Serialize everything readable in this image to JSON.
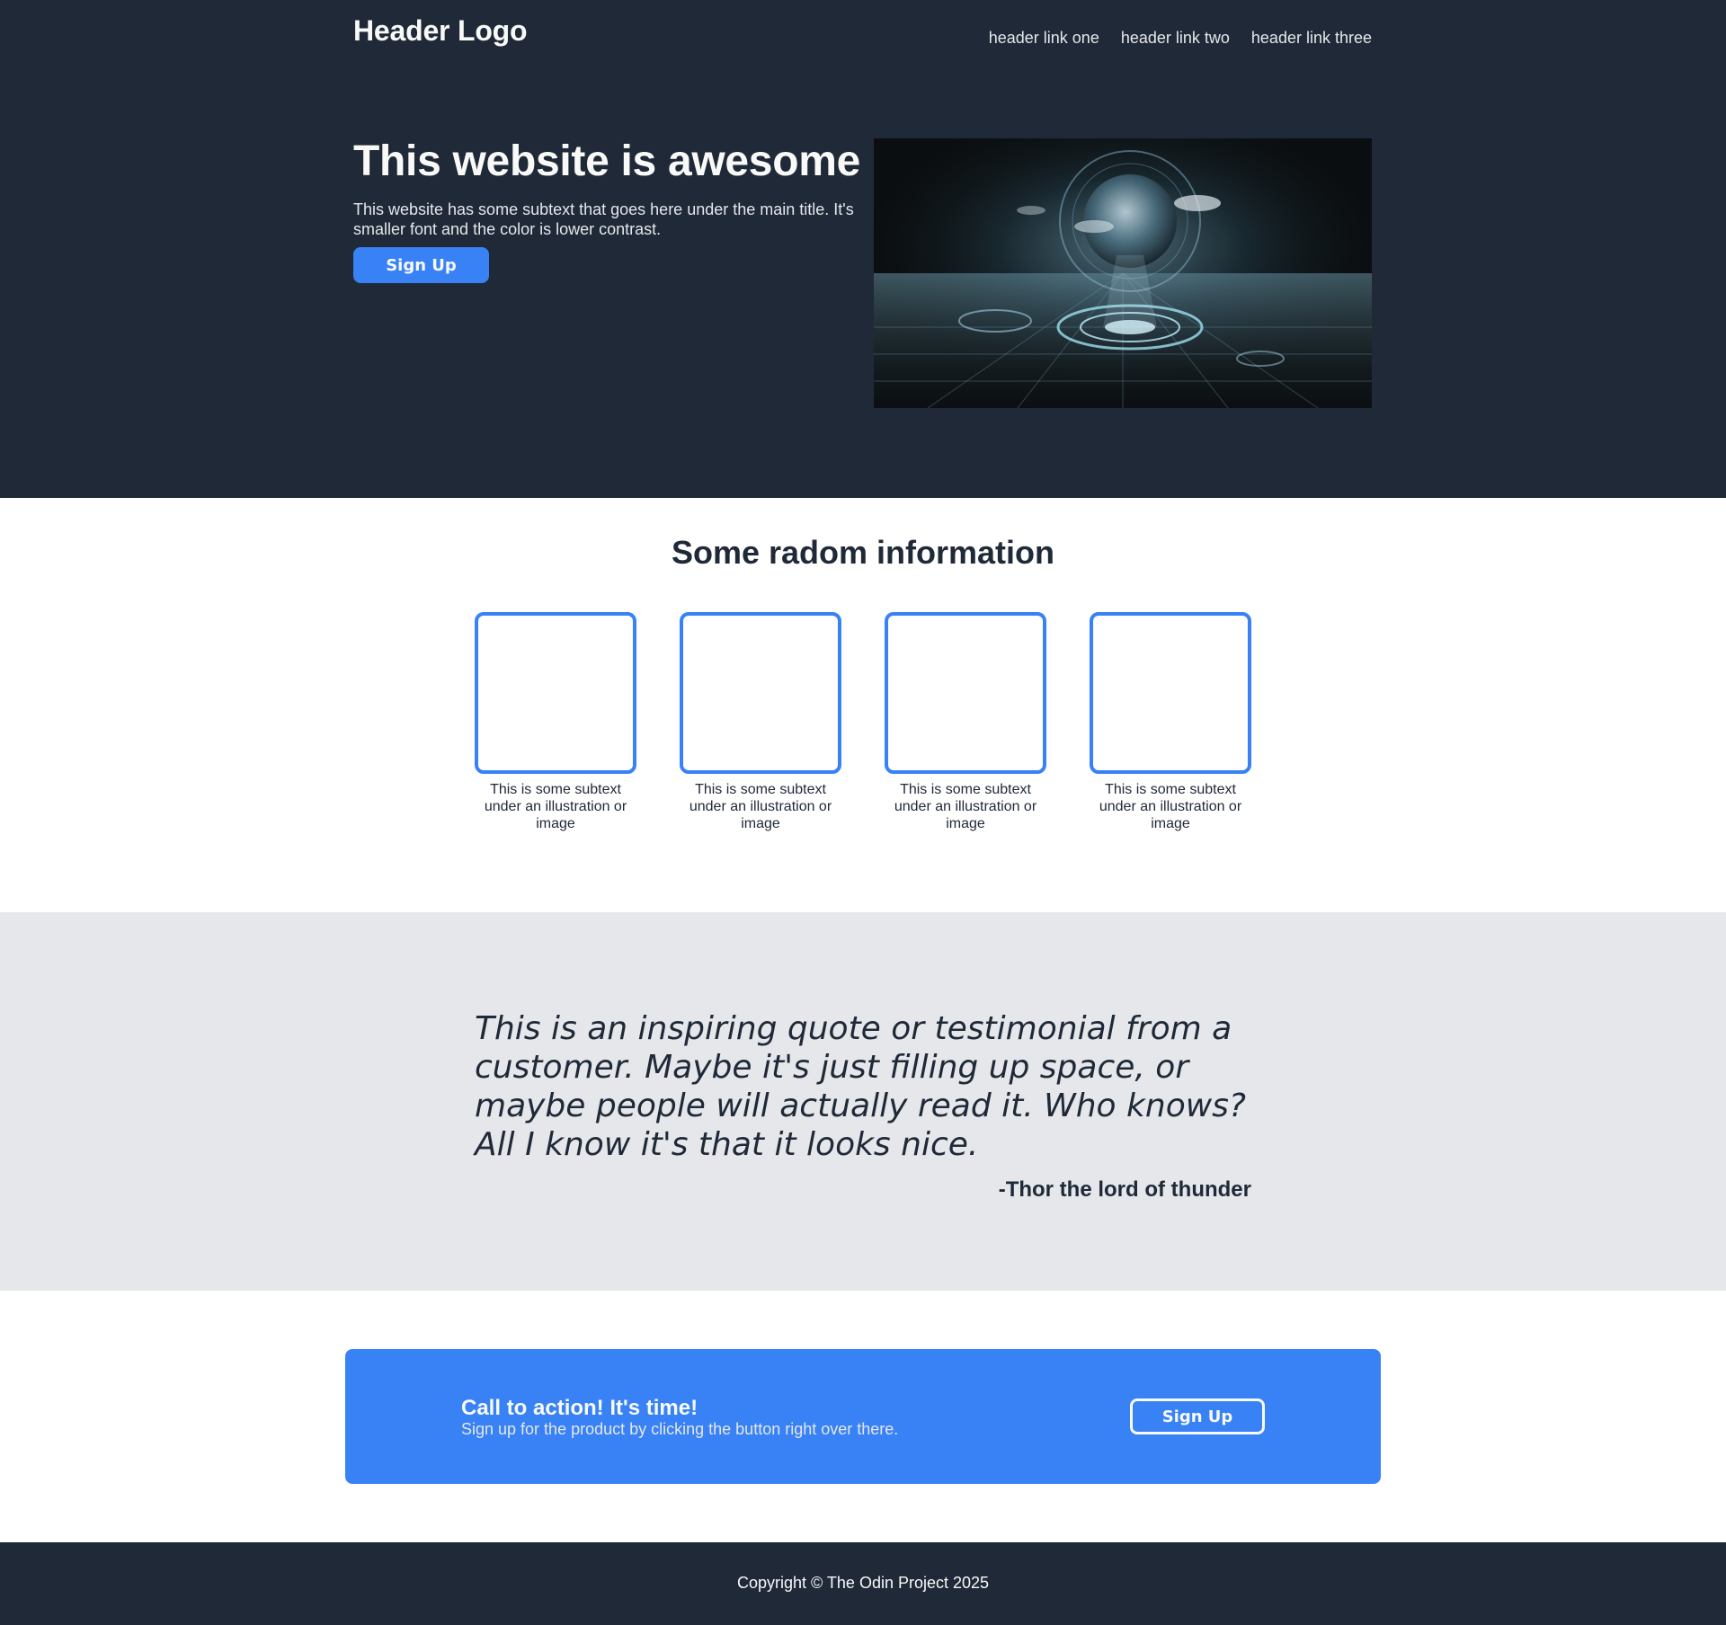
{
  "header": {
    "logo": "Header Logo",
    "links": [
      "header link one",
      "header link two",
      "header link three"
    ]
  },
  "hero": {
    "title": "This website is awesome",
    "subtitle": "This website has some subtext that goes here under the main title. It's smaller font and the color is lower contrast.",
    "button_label": "Sign Up",
    "image_icon": "futuristic-globe-illustration"
  },
  "info": {
    "title": "Some radom information",
    "cards": [
      {
        "text": "This is some subtext under an illustration or image"
      },
      {
        "text": "This is some subtext under an illustration or image"
      },
      {
        "text": "This is some subtext under an illustration or image"
      },
      {
        "text": "This is some subtext under an illustration or image"
      }
    ]
  },
  "quote": {
    "text": "This is an inspiring quote or testimonial from a customer. Maybe it's just filling up space, or maybe people will actually read it. Who knows? All I know it's that it looks nice.",
    "author": "-Thor the lord of thunder"
  },
  "cta": {
    "title": "Call to action! It's time!",
    "subtitle": "Sign up for the product by clicking the button right over there.",
    "button_label": "Sign Up"
  },
  "footer": {
    "copyright": "Copyright © The Odin Project 2025"
  },
  "colors": {
    "dark": "#1f2937",
    "accent": "#3882f6",
    "light_gray": "#e5e7eb",
    "off_white": "#f9faf8"
  }
}
